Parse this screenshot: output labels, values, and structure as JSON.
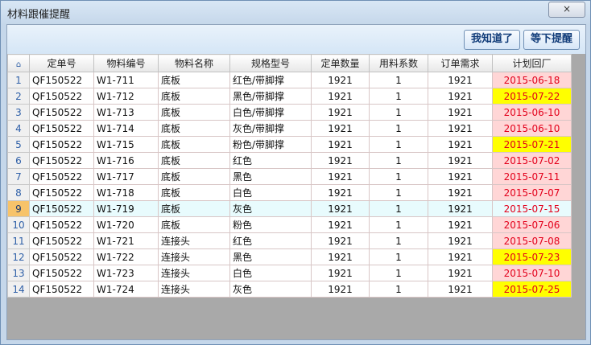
{
  "window": {
    "title": "材料跟催提醒",
    "close": "×"
  },
  "toolbar": {
    "ack": "我知道了",
    "later": "等下提醒"
  },
  "table": {
    "corner": "⌂",
    "headers": [
      "定单号",
      "物料编号",
      "物料名称",
      "规格型号",
      "定单数量",
      "用料系数",
      "订单需求",
      "计划回厂"
    ],
    "rows": [
      {
        "n": "1",
        "order": "QF150522",
        "code": "W1-711",
        "name": "底板",
        "spec": "红色/带脚撑",
        "qty": "1921",
        "coef": "1",
        "demand": "1921",
        "date": "2015-06-18",
        "hl": false
      },
      {
        "n": "2",
        "order": "QF150522",
        "code": "W1-712",
        "name": "底板",
        "spec": "黑色/带脚撑",
        "qty": "1921",
        "coef": "1",
        "demand": "1921",
        "date": "2015-07-22",
        "hl": true
      },
      {
        "n": "3",
        "order": "QF150522",
        "code": "W1-713",
        "name": "底板",
        "spec": "白色/带脚撑",
        "qty": "1921",
        "coef": "1",
        "demand": "1921",
        "date": "2015-06-10",
        "hl": false
      },
      {
        "n": "4",
        "order": "QF150522",
        "code": "W1-714",
        "name": "底板",
        "spec": "灰色/带脚撑",
        "qty": "1921",
        "coef": "1",
        "demand": "1921",
        "date": "2015-06-10",
        "hl": false
      },
      {
        "n": "5",
        "order": "QF150522",
        "code": "W1-715",
        "name": "底板",
        "spec": "粉色/带脚撑",
        "qty": "1921",
        "coef": "1",
        "demand": "1921",
        "date": "2015-07-21",
        "hl": true
      },
      {
        "n": "6",
        "order": "QF150522",
        "code": "W1-716",
        "name": "底板",
        "spec": "红色",
        "qty": "1921",
        "coef": "1",
        "demand": "1921",
        "date": "2015-07-02",
        "hl": false
      },
      {
        "n": "7",
        "order": "QF150522",
        "code": "W1-717",
        "name": "底板",
        "spec": "黑色",
        "qty": "1921",
        "coef": "1",
        "demand": "1921",
        "date": "2015-07-11",
        "hl": false
      },
      {
        "n": "8",
        "order": "QF150522",
        "code": "W1-718",
        "name": "底板",
        "spec": "白色",
        "qty": "1921",
        "coef": "1",
        "demand": "1921",
        "date": "2015-07-07",
        "hl": false
      },
      {
        "n": "9",
        "order": "QF150522",
        "code": "W1-719",
        "name": "底板",
        "spec": "灰色",
        "qty": "1921",
        "coef": "1",
        "demand": "1921",
        "date": "2015-07-15",
        "hl": false,
        "selected": true
      },
      {
        "n": "10",
        "order": "QF150522",
        "code": "W1-720",
        "name": "底板",
        "spec": "粉色",
        "qty": "1921",
        "coef": "1",
        "demand": "1921",
        "date": "2015-07-06",
        "hl": false
      },
      {
        "n": "11",
        "order": "QF150522",
        "code": "W1-721",
        "name": "连接头",
        "spec": "红色",
        "qty": "1921",
        "coef": "1",
        "demand": "1921",
        "date": "2015-07-08",
        "hl": false
      },
      {
        "n": "12",
        "order": "QF150522",
        "code": "W1-722",
        "name": "连接头",
        "spec": "黑色",
        "qty": "1921",
        "coef": "1",
        "demand": "1921",
        "date": "2015-07-23",
        "hl": true
      },
      {
        "n": "13",
        "order": "QF150522",
        "code": "W1-723",
        "name": "连接头",
        "spec": "白色",
        "qty": "1921",
        "coef": "1",
        "demand": "1921",
        "date": "2015-07-10",
        "hl": false
      },
      {
        "n": "14",
        "order": "QF150522",
        "code": "W1-724",
        "name": "连接头",
        "spec": "灰色",
        "qty": "1921",
        "coef": "1",
        "demand": "1921",
        "date": "2015-07-25",
        "hl": true
      }
    ]
  }
}
